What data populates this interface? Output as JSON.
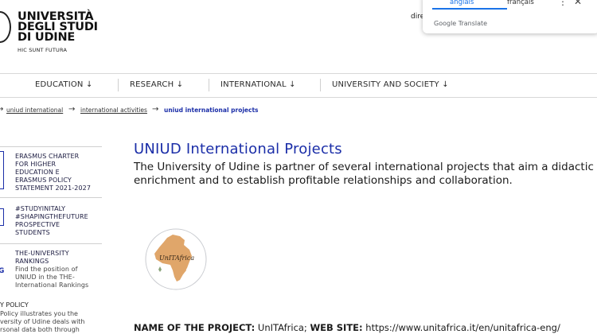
{
  "header": {
    "university_name_lines": [
      "UNIVERSITÀ",
      "DEGLI STUDI",
      "DI UDINE"
    ],
    "motto": "HIC SUNT FUTURA",
    "lang_partial": "dire"
  },
  "translate_popup": {
    "tab_selected": "anglais",
    "tab_other": "français",
    "more_icon": "⋮",
    "close_icon": "✕",
    "brand": "Google Translate"
  },
  "nav": {
    "items": [
      {
        "label": "EDUCATION ↓"
      },
      {
        "label": "RESEARCH ↓"
      },
      {
        "label": "INTERNATIONAL ↓"
      },
      {
        "label": "UNIVERSITY AND SOCIETY ↓"
      }
    ]
  },
  "breadcrumb": {
    "items": [
      "uniud international",
      "international activities",
      "uniud international projects"
    ],
    "separator": "→"
  },
  "sidebar": {
    "items": [
      {
        "title_lines": [
          "ERASMUS CHARTER",
          "FOR HIGHER",
          "EDUCATION E",
          "ERASMUS POLICY",
          "STATEMENT 2021-2027"
        ]
      },
      {
        "title_lines": [
          "#STUDYINITALY",
          "#SHAPINGTHEFUTURE",
          "PROSPECTIVE",
          "STUDENTS"
        ]
      },
      {
        "title_lines": [
          "THE-UNIVERSITY",
          "RANKINGS"
        ],
        "text_lines": [
          "Find the position of",
          "UNIUD in the THE-",
          "International Rankings"
        ]
      }
    ],
    "policy_title": "Y POLICY",
    "policy_text_lines": [
      "Policy illustrates you the",
      "versity of Udine deals with",
      "rsonal data both through"
    ]
  },
  "main": {
    "title": "UNIUD International Projects",
    "intro": "The University of Udine is partner of several international projects that aim a didactic enrichment and to establish profitable relationships and collaboration.",
    "project_label": "NAME OF THE PROJECT:",
    "project_name": "UnITAfrica;",
    "site_label": "WEB SITE:",
    "site_url": "https://www.unitafrica.it/en/unitafrica-eng/",
    "logo_text": "UnITAfrica"
  },
  "colors": {
    "accent_blue": "#1b2ea8",
    "logo_orange": "#e0a66a"
  }
}
